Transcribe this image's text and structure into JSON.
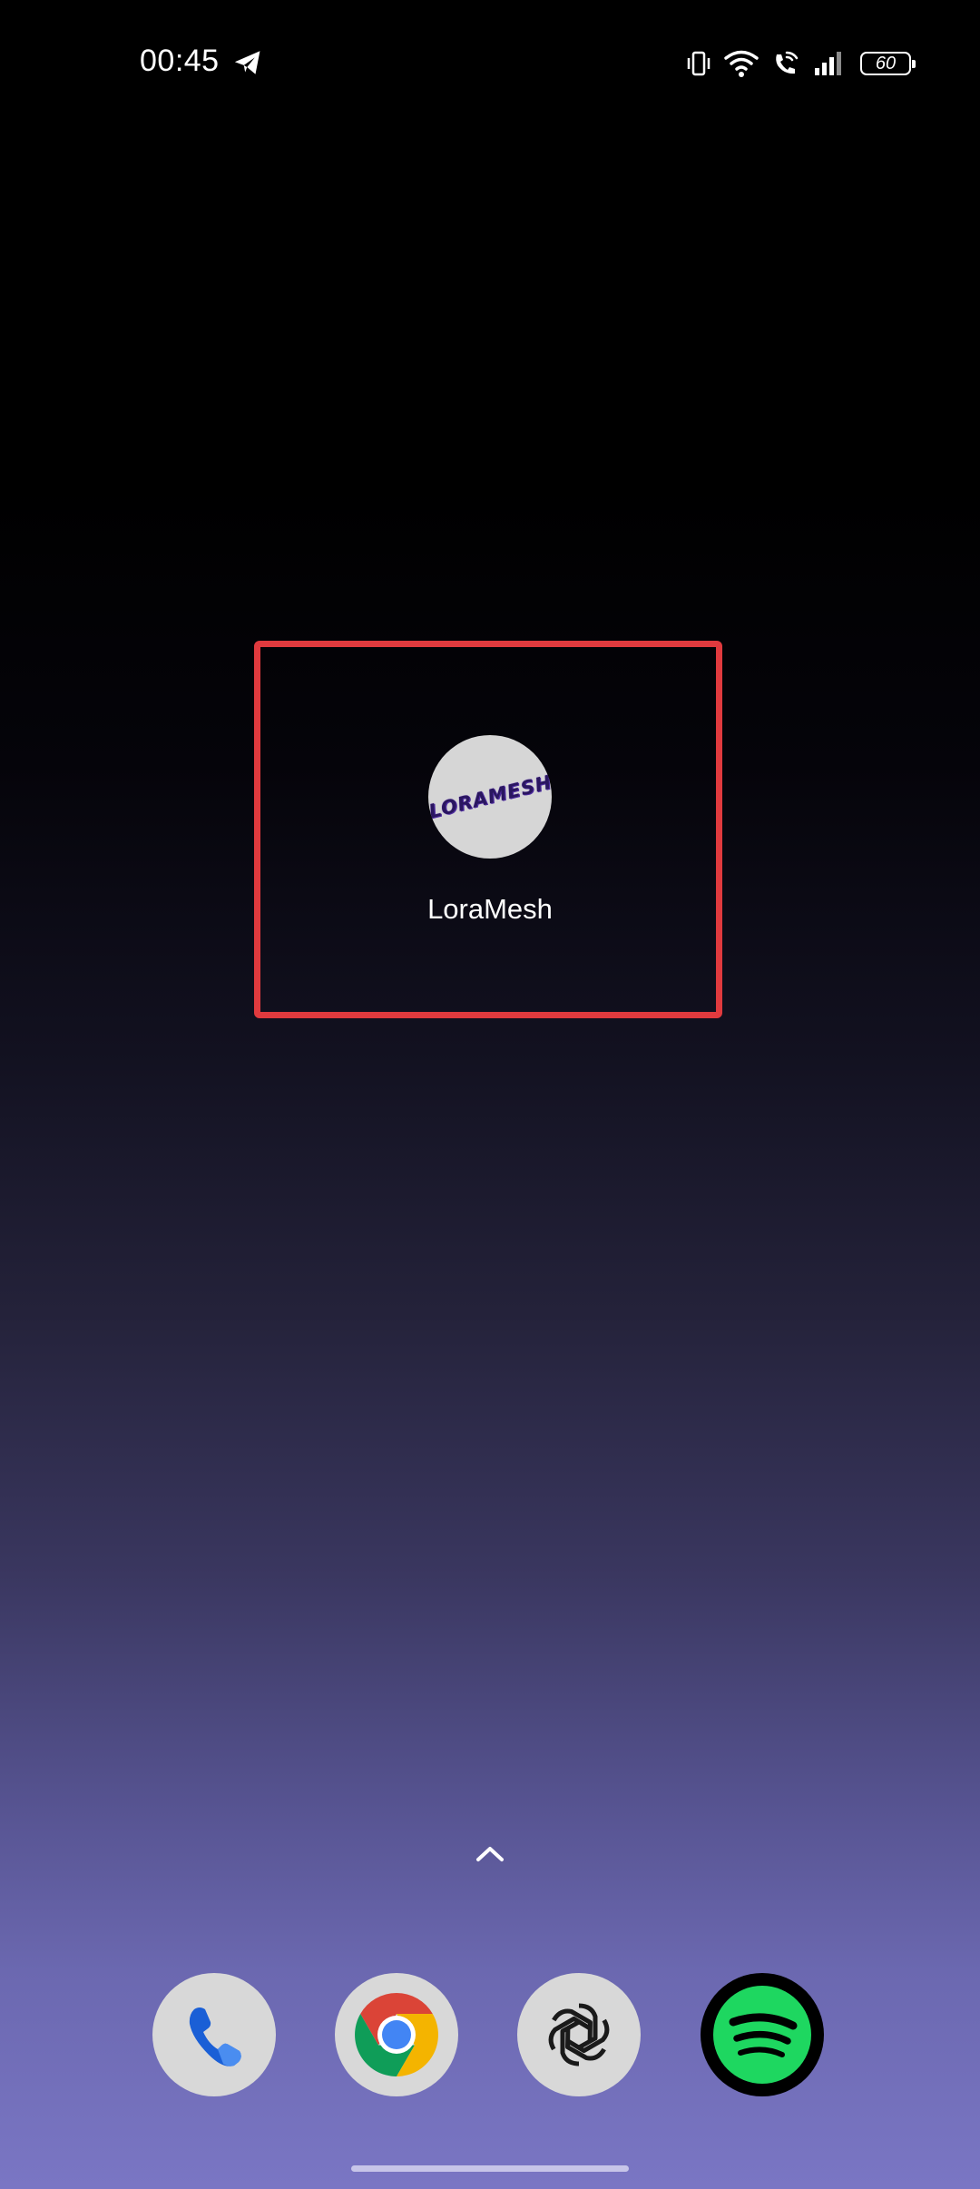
{
  "status_bar": {
    "time": "00:45",
    "battery_level": "60",
    "icons": [
      "telegram-icon",
      "vibrate-icon",
      "wifi-icon",
      "wifi-calling-icon",
      "cellular-signal-icon",
      "battery-icon"
    ]
  },
  "home_screen": {
    "app": {
      "label": "LoraMesh",
      "logo_text": "LORAMESH",
      "icon": "loramesh-icon"
    },
    "highlight_color": "#e03a3e",
    "app_drawer_hint_icon": "chevron-up-icon"
  },
  "dock": {
    "apps": [
      {
        "name": "Phone",
        "icon": "phone-icon"
      },
      {
        "name": "Chrome",
        "icon": "chrome-icon"
      },
      {
        "name": "ChatGPT",
        "icon": "chatgpt-icon"
      },
      {
        "name": "Spotify",
        "icon": "spotify-icon"
      }
    ]
  },
  "colors": {
    "wallpaper_top": "#000000",
    "wallpaper_bottom": "#7a76c4",
    "spotify_green": "#1ed760",
    "phone_blue": "#1a73e8"
  }
}
